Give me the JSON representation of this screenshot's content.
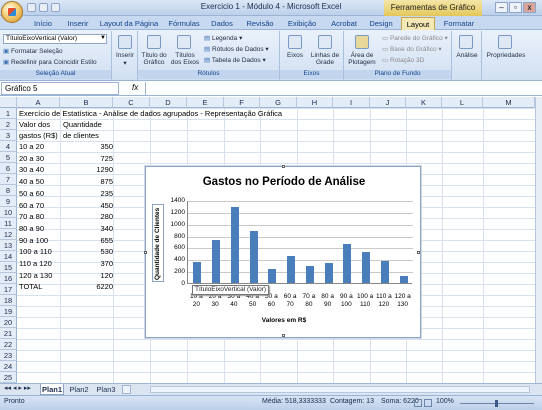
{
  "window": {
    "title": "Exercicio 1 - Módulo 4 - Microsoft Excel",
    "context_tab": "Ferramentas de Gráfico",
    "buttons": [
      "–",
      "▫",
      "x"
    ]
  },
  "ribbon_tabs": [
    "Início",
    "Inserir",
    "Layout da Página",
    "Fórmulas",
    "Dados",
    "Revisão",
    "Exibição",
    "Acrobat",
    "Design",
    "Layout",
    "Formatar"
  ],
  "active_tab": "Layout",
  "ribbon": {
    "selection_dropdown": "TítuloEixoVertical (Valor)",
    "format_selection": "Formatar Seleção",
    "reset_style": "Redefinir para Coincidir Estilo",
    "group_selection": "Seleção Atual",
    "insert": "Inserir",
    "chart_title": "Título do Gráfico",
    "axis_titles": "Títulos dos Eixos",
    "legend": "Legenda",
    "data_labels": "Rótulos de Dados",
    "data_table": "Tabela de Dados",
    "group_labels": "Rótulos",
    "axes": "Eixos",
    "gridlines": "Linhas de Grade",
    "group_axes": "Eixos",
    "plot_area": "Área de Plotagem",
    "chart_wall": "Parede do Gráfico",
    "chart_floor": "Base do Gráfico",
    "rotation_3d": "Rotação 3D",
    "group_background": "Plano de Fundo",
    "analysis": "Análise",
    "properties": "Propriedades"
  },
  "formula_bar": {
    "name_box": "Gráfico 5",
    "fx": "fx",
    "formula": ""
  },
  "columns": [
    "A",
    "B",
    "C",
    "D",
    "E",
    "F",
    "G",
    "H",
    "I",
    "J",
    "K",
    "L",
    "M"
  ],
  "rows": [
    "1",
    "2",
    "3",
    "4",
    "5",
    "6",
    "7",
    "8",
    "9",
    "10",
    "11",
    "12",
    "13",
    "14",
    "15",
    "16",
    "17",
    "18",
    "19",
    "20",
    "21",
    "22",
    "23",
    "24",
    "25"
  ],
  "sheet": {
    "a1": "Exercício de Estatística - Análise de dados agrupados - Representação Gráfica",
    "header_a1": "Valor dos",
    "header_a2": "gastos (R$)",
    "header_b1": "Quantidade",
    "header_b2": "de clientes",
    "data": [
      {
        "range": "10 a 20",
        "count": "350"
      },
      {
        "range": "20 a 30",
        "count": "725"
      },
      {
        "range": "30 a 40",
        "count": "1290"
      },
      {
        "range": "40 a 50",
        "count": "875"
      },
      {
        "range": "50 a 60",
        "count": "235"
      },
      {
        "range": "60 a 70",
        "count": "450"
      },
      {
        "range": "70 a 80",
        "count": "280"
      },
      {
        "range": "80 a 90",
        "count": "340"
      },
      {
        "range": "90 a 100",
        "count": "655"
      },
      {
        "range": "100 a 110",
        "count": "530"
      },
      {
        "range": "110 a 120",
        "count": "370"
      },
      {
        "range": "120 a 130",
        "count": "120"
      }
    ],
    "total_label": "TOTAL",
    "total_value": "6220"
  },
  "chart_data": {
    "type": "bar",
    "title": "Gastos no Período de Análise",
    "xlabel": "Valores em R$",
    "ylabel": "Quantidade de Clientes",
    "categories": [
      "10 a 20",
      "20 a 30",
      "30 a 40",
      "40 a 50",
      "50 a 60",
      "60 a 70",
      "70 a 80",
      "80 a 90",
      "90 a 100",
      "100 a 110",
      "110 a 120",
      "120 a 130"
    ],
    "category_lines": [
      [
        "10 a",
        "20"
      ],
      [
        "20 a",
        "30"
      ],
      [
        "30 a",
        "40"
      ],
      [
        "40 a",
        "50"
      ],
      [
        "50 a",
        "60"
      ],
      [
        "60 a",
        "70"
      ],
      [
        "70 a",
        "80"
      ],
      [
        "80 a",
        "90"
      ],
      [
        "90 a",
        "100"
      ],
      [
        "100 a",
        "110"
      ],
      [
        "110 a",
        "120"
      ],
      [
        "120 a",
        "130"
      ]
    ],
    "values": [
      350,
      725,
      1290,
      875,
      235,
      450,
      280,
      340,
      655,
      530,
      370,
      120
    ],
    "ylim": [
      0,
      1400
    ],
    "yticks": [
      0,
      200,
      400,
      600,
      800,
      1000,
      1200,
      1400
    ],
    "grid": true,
    "bar_color": "#4a7ebb"
  },
  "tooltip": "TítuloEixoVertical (Valor)",
  "sheet_tabs": [
    "Plan1",
    "Plan2",
    "Plan3"
  ],
  "active_sheet": "Plan1",
  "status": {
    "ready": "Pronto",
    "average": "Média: 518,3333333",
    "count": "Contagem: 13",
    "sum": "Soma: 6220",
    "zoom": "100%"
  }
}
